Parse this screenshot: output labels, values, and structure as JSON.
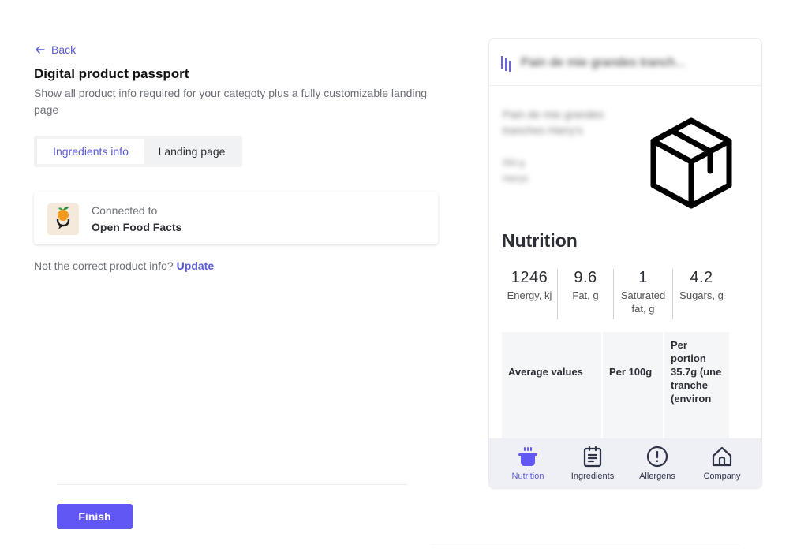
{
  "nav": {
    "back_label": "Back"
  },
  "page": {
    "title": "Digital product passport",
    "description": "Show all product info required for your categoty plus a fully customizable landing page"
  },
  "tabs": [
    {
      "label": "Ingredients info",
      "active": true
    },
    {
      "label": "Landing page",
      "active": false
    }
  ],
  "connection": {
    "label": "Connected to",
    "name": "Open Food Facts",
    "logo_icon": "open-food-facts-logo"
  },
  "prompt": {
    "text": "Not the correct product info?",
    "link": "Update"
  },
  "footer": {
    "finish_label": "Finish"
  },
  "preview": {
    "title": "Pain de mie grandes tranch...",
    "product_name": "Pain de mie grandes tranches Harry's",
    "product_detail_1": "550 g",
    "product_detail_2": "Harrys",
    "product_icon": "package-box-icon",
    "nutrition_title": "Nutrition",
    "stats": [
      {
        "value": "1246",
        "label": "Energy, kj"
      },
      {
        "value": "9.6",
        "label": "Fat, g"
      },
      {
        "value": "1",
        "label": "Saturated fat, g"
      },
      {
        "value": "4.2",
        "label": "Sugars, g"
      }
    ],
    "table_headers": [
      "Average values",
      "Per 100g",
      "Per portion 35.7g (une tranche (environ"
    ],
    "bottom_nav": [
      {
        "label": "Nutrition",
        "icon": "pot-icon",
        "active": true
      },
      {
        "label": "Ingredients",
        "icon": "clipboard-list-icon",
        "active": false
      },
      {
        "label": "Allergens",
        "icon": "alert-circle-icon",
        "active": false
      },
      {
        "label": "Company",
        "icon": "home-icon",
        "active": false
      }
    ]
  },
  "colors": {
    "accent": "#5b5bd6",
    "button": "#6157f5",
    "nav_background": "#eef0f5"
  }
}
